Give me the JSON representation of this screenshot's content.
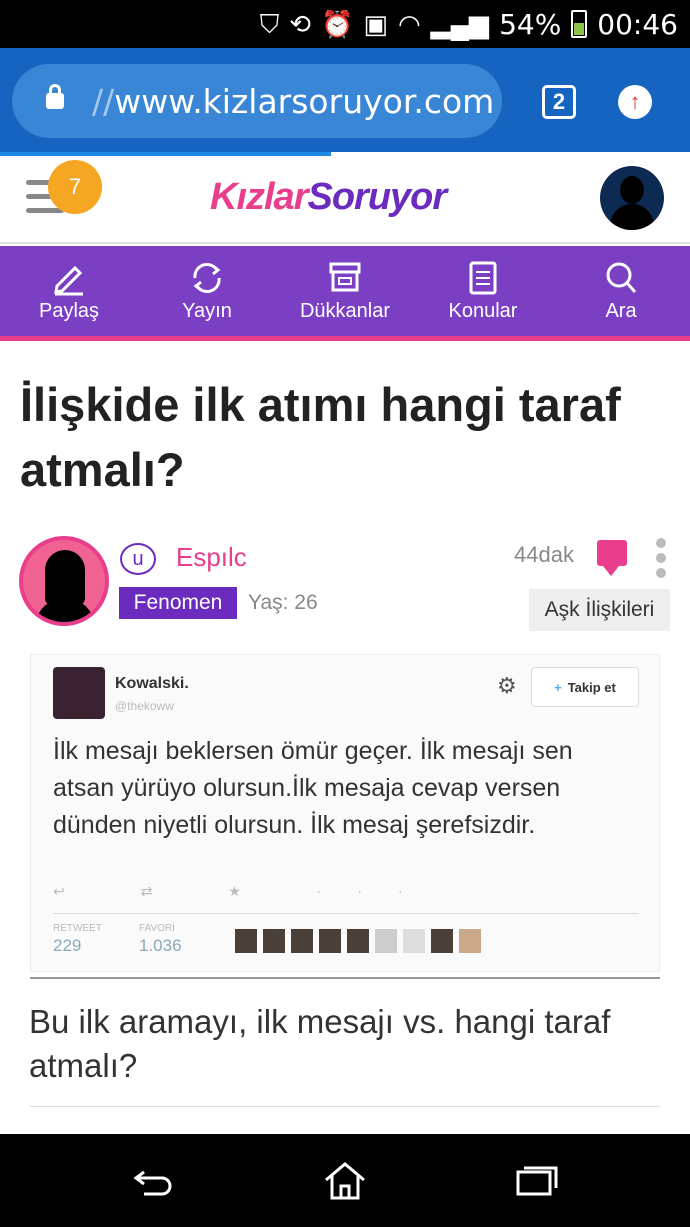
{
  "status_bar": {
    "battery_percent": "54%",
    "clock": "00:46",
    "icons": [
      "shield-icon",
      "rotate-icon",
      "alarm-icon",
      "sim-icon",
      "wifi-icon",
      "signal-icon",
      "battery-icon"
    ]
  },
  "browser": {
    "url_prefix": "//",
    "url_host": "www.kizlarsoruyor.com",
    "tab_count": "2",
    "progress": 0.48
  },
  "site": {
    "notification_count": "7",
    "logo_part1": "Kızlar",
    "logo_part2": "Soruyor",
    "brand_pink": "#e83e8c",
    "brand_purple": "#7b3fc4"
  },
  "nav": {
    "items": [
      {
        "label": "Paylaş",
        "icon": "pencil-icon"
      },
      {
        "label": "Yayın",
        "icon": "refresh-icon"
      },
      {
        "label": "Dükkanlar",
        "icon": "store-icon"
      },
      {
        "label": "Konular",
        "icon": "list-icon"
      },
      {
        "label": "Ara",
        "icon": "search-icon"
      }
    ]
  },
  "question": {
    "title": "İlişkide ilk atımı hangi taraf atmalı?",
    "author": {
      "level_icon": "u",
      "username": "Espılc",
      "badge": "Fenomen",
      "age": "Yaş: 26"
    },
    "time": "44dak",
    "category": "Aşk İlişkileri",
    "body": "Bu ilk aramayı, ilk mesajı vs. hangi taraf atmalı?"
  },
  "tweet": {
    "name": "Kowalski.",
    "handle": "@thekoww",
    "follow_label": "Takip et",
    "text": "İlk mesajı beklersen ömür geçer. İlk mesajı sen atsan yürüyo olursun.İlk mesaja cevap versen  dünden niyetli olursun. İlk mesaj şerefsizdir.",
    "actions": "↩ ⇄ ★ ···",
    "retweet_label": "RETWEET",
    "retweet_count": "229",
    "favorite_label": "FAVORİ",
    "favorite_count": "1.036"
  }
}
